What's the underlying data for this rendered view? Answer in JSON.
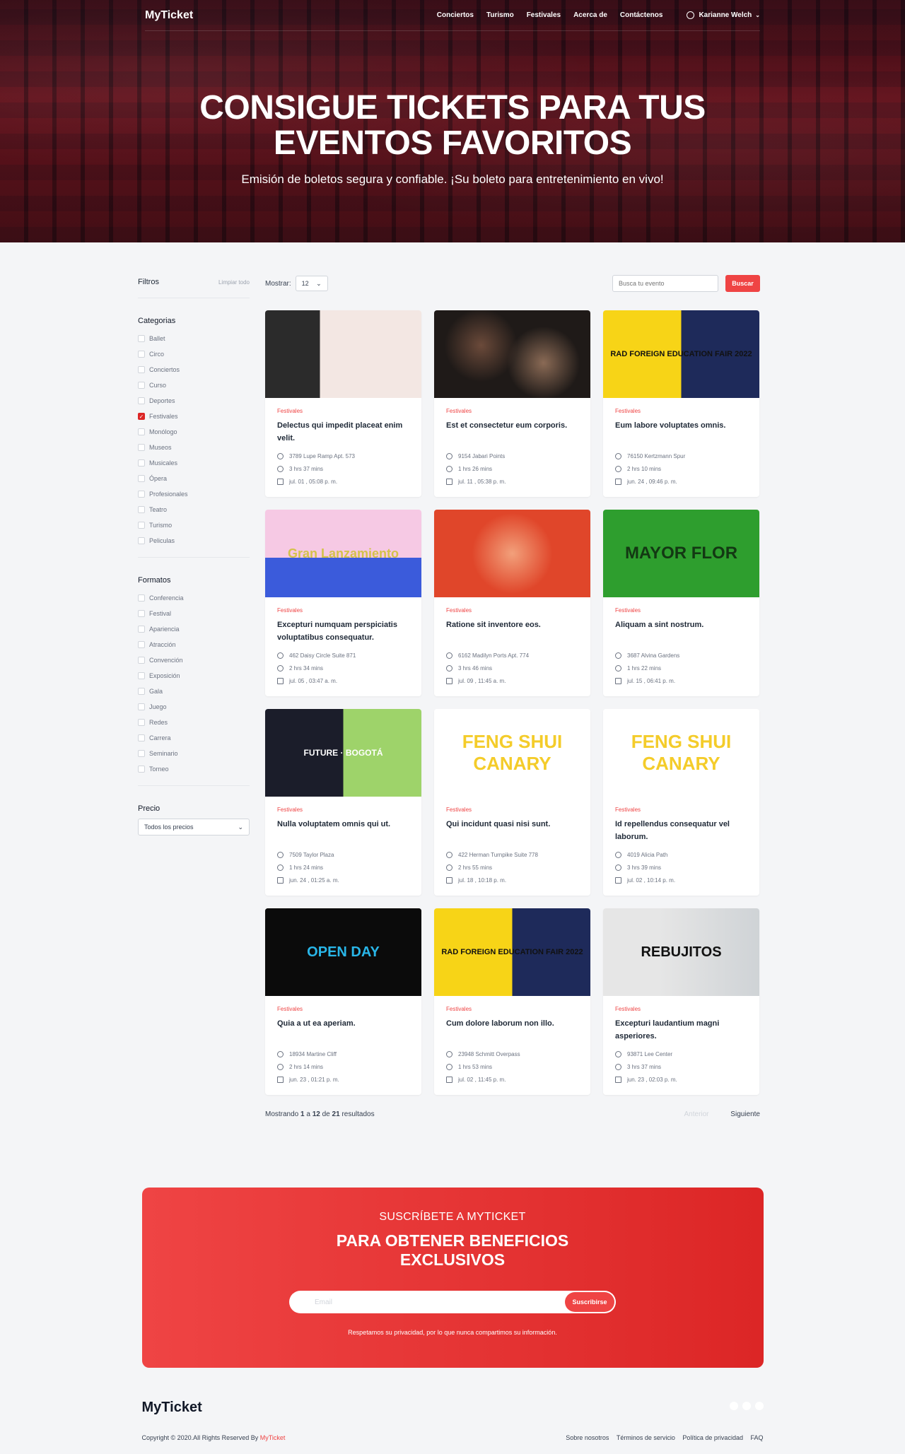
{
  "header": {
    "logo": "MyTicket",
    "nav": [
      "Conciertos",
      "Turismo",
      "Festivales",
      "Acerca de",
      "Contáctenos"
    ],
    "user": "Karianne Welch"
  },
  "hero": {
    "title_line1": "CONSIGUE TICKETS PARA TUS",
    "title_line2": "EVENTOS FAVORITOS",
    "subtitle": "Emisión de boletos segura y confiable. ¡Su boleto para entretenimiento en vivo!"
  },
  "filters": {
    "title": "Filtros",
    "clear": "Limpiar todo",
    "categories_title": "Categorias",
    "categories": [
      {
        "label": "Ballet",
        "checked": false
      },
      {
        "label": "Circo",
        "checked": false
      },
      {
        "label": "Conciertos",
        "checked": false
      },
      {
        "label": "Curso",
        "checked": false
      },
      {
        "label": "Deportes",
        "checked": false
      },
      {
        "label": "Festivales",
        "checked": true
      },
      {
        "label": "Monólogo",
        "checked": false
      },
      {
        "label": "Museos",
        "checked": false
      },
      {
        "label": "Musicales",
        "checked": false
      },
      {
        "label": "Ópera",
        "checked": false
      },
      {
        "label": "Profesionales",
        "checked": false
      },
      {
        "label": "Teatro",
        "checked": false
      },
      {
        "label": "Turismo",
        "checked": false
      },
      {
        "label": "Peliculas",
        "checked": false
      }
    ],
    "formats_title": "Formatos",
    "formats": [
      "Conferencia",
      "Festival",
      "Apariencia",
      "Atracción",
      "Convención",
      "Exposición",
      "Gala",
      "Juego",
      "Redes",
      "Carrera",
      "Seminario",
      "Torneo"
    ],
    "price_title": "Precio",
    "price_value": "Todos los precios"
  },
  "toolbar": {
    "show_label": "Mostrar:",
    "show_value": "12",
    "search_placeholder": "Busca tu evento",
    "search_button": "Buscar"
  },
  "events": [
    {
      "category": "Festivales",
      "title": "Delectus qui impedit placeat enim velit.",
      "address": "3789 Lupe Ramp Apt. 573",
      "duration": "3 hrs 37 mins",
      "date": "jul. 01 , 05:08 p. m.",
      "thumb": "art",
      "thumb_text": ""
    },
    {
      "category": "Festivales",
      "title": "Est et consectetur eum corporis.",
      "address": "9154 Jabari Points",
      "duration": "1 hrs 26 mins",
      "date": "jul. 11 , 05:38 p. m.",
      "thumb": "crowd",
      "thumb_text": ""
    },
    {
      "category": "Festivales",
      "title": "Eum labore voluptates omnis.",
      "address": "76150 Kertzmann Spur",
      "duration": "2 hrs 10 mins",
      "date": "jun. 24 , 09:46 p. m.",
      "thumb": "fair",
      "thumb_text": "RAD FOREIGN EDUCATION FAIR 2022"
    },
    {
      "category": "Festivales",
      "title": "Excepturi numquam perspiciatis voluptatibus consequatur.",
      "address": "462 Daisy Circle Suite 871",
      "duration": "2 hrs 34 mins",
      "date": "jul. 05 , 03:47 a. m.",
      "thumb": "gran",
      "thumb_text": "Gran Lanzamiento"
    },
    {
      "category": "Festivales",
      "title": "Ratione sit inventore eos.",
      "address": "6162 Madilyn Ports Apt. 774",
      "duration": "3 hrs 46 mins",
      "date": "jul. 09 , 11:45 a. m.",
      "thumb": "friends",
      "thumb_text": ""
    },
    {
      "category": "Festivales",
      "title": "Aliquam a sint nostrum.",
      "address": "3687 Alvina Gardens",
      "duration": "1 hrs 22 mins",
      "date": "jul. 15 , 06:41 p. m.",
      "thumb": "mayor",
      "thumb_text": "MAYOR FLOR"
    },
    {
      "category": "Festivales",
      "title": "Nulla voluptatem omnis qui ut.",
      "address": "7509 Taylor Plaza",
      "duration": "1 hrs 24 mins",
      "date": "jun. 24 , 01:25 a. m.",
      "thumb": "future",
      "thumb_text": "FUTURE · BOGOTÁ"
    },
    {
      "category": "Festivales",
      "title": "Qui incidunt quasi nisi sunt.",
      "address": "422 Herman Turnpike Suite 778",
      "duration": "2 hrs 55 mins",
      "date": "jul. 18 , 10:18 p. m.",
      "thumb": "canary",
      "thumb_text": "FENG SHUI CANARY"
    },
    {
      "category": "Festivales",
      "title": "Id repellendus consequatur vel laborum.",
      "address": "4019 Alicia Path",
      "duration": "3 hrs 39 mins",
      "date": "jul. 02 , 10:14 p. m.",
      "thumb": "canary",
      "thumb_text": "FENG SHUI CANARY"
    },
    {
      "category": "Festivales",
      "title": "Quia a ut ea aperiam.",
      "address": "18934 Martine Cliff",
      "duration": "2 hrs 14 mins",
      "date": "jun. 23 , 01:21 p. m.",
      "thumb": "openday",
      "thumb_text": "OPEN DAY"
    },
    {
      "category": "Festivales",
      "title": "Cum dolore laborum non illo.",
      "address": "23948 Schmitt Overpass",
      "duration": "1 hrs 53 mins",
      "date": "jul. 02 , 11:45 p. m.",
      "thumb": "fair",
      "thumb_text": "RAD FOREIGN EDUCATION FAIR 2022"
    },
    {
      "category": "Festivales",
      "title": "Excepturi laudantium magni asperiores.",
      "address": "93871 Lee Center",
      "duration": "3 hrs 37 mins",
      "date": "jun. 23 , 02:03 p. m.",
      "thumb": "rebujitos",
      "thumb_text": "REBUJITOS"
    }
  ],
  "pagination": {
    "summary_prefix": "Mostrando",
    "from": "1",
    "to_label": "a",
    "to": "12",
    "of_label": "de",
    "total": "21",
    "suffix": "resultados",
    "prev": "Anterior",
    "next": "Siguiente"
  },
  "subscribe": {
    "kicker": "SUSCRÍBETE A MYTICKET",
    "title_line1": "PARA OBTENER BENEFICIOS",
    "title_line2": "EXCLUSIVOS",
    "email_placeholder": "Email",
    "button": "Suscribirse",
    "note": "Respetamos su privacidad, por lo que nunca compartimos su información."
  },
  "footer": {
    "logo": "MyTicket",
    "copyright": "Copyright © 2020.All Rights Reserved By",
    "brand": "MyTicket",
    "links": [
      "Sobre nosotros",
      "Términos de servicio",
      "Política de privacidad",
      "FAQ"
    ]
  }
}
